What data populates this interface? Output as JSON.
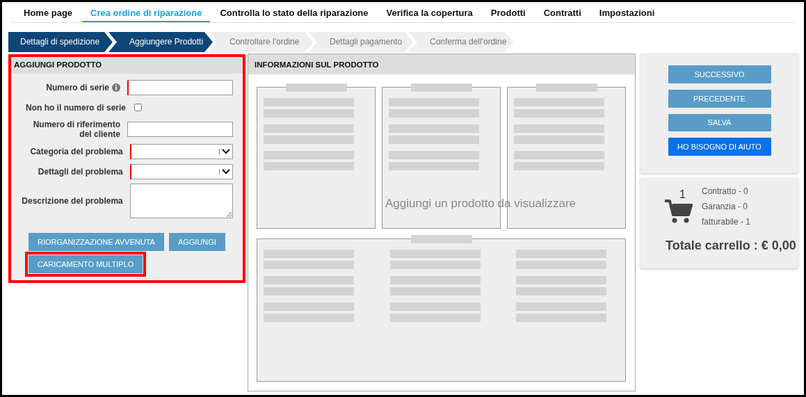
{
  "nav": [
    {
      "label": "Home page",
      "selected": false
    },
    {
      "label": "Crea ordine di riparazione",
      "selected": true
    },
    {
      "label": "Controlla lo stato della riparazione",
      "selected": false
    },
    {
      "label": "Verifica la copertura",
      "selected": false
    },
    {
      "label": "Prodotti",
      "selected": false
    },
    {
      "label": "Contratti",
      "selected": false
    },
    {
      "label": "Impostazioni",
      "selected": false
    }
  ],
  "steps": [
    {
      "label": "Dettagli di spedizione",
      "done": true
    },
    {
      "label": "Aggiungere Prodotti",
      "done": true
    },
    {
      "label": "Controllare l'ordine",
      "done": false
    },
    {
      "label": "Dettagli pagamento",
      "done": false
    },
    {
      "label": "Conferma dell'ordine",
      "done": false
    }
  ],
  "add_product": {
    "title": "AGGIUNGI PRODOTTO",
    "highlighted": true,
    "fields": [
      {
        "kind": "text",
        "label": "Numero di serie",
        "info": true,
        "required": true
      },
      {
        "kind": "checkbox",
        "label": "Non ho il numero di serie",
        "checked": false
      },
      {
        "kind": "text",
        "label": "Numero di riferimento del cliente",
        "info": false,
        "required": false
      },
      {
        "kind": "select",
        "label": "Categoria del problema",
        "required": true
      },
      {
        "kind": "select",
        "label": "Dettagli del problema",
        "required": true
      },
      {
        "kind": "textarea",
        "label": "Descrizione del problema",
        "required": false
      }
    ],
    "buttons": [
      {
        "label": "RIORGANIZZAZIONE AVVENUTA",
        "highlighted": false
      },
      {
        "label": "AGGIUNGI",
        "highlighted": false
      },
      {
        "label": "CARICAMENTO MULTIPLO",
        "highlighted": true
      }
    ]
  },
  "product_info": {
    "title": "INFORMAZIONI SUL PRODOTTO",
    "empty_message": "Aggiungi un prodotto da visualizzare"
  },
  "actions": [
    {
      "label": "SUCCESSIVO",
      "kind": "secondary"
    },
    {
      "label": "PRECEDENTE",
      "kind": "secondary"
    },
    {
      "label": "SALVA",
      "kind": "secondary"
    },
    {
      "label": "HO BISOGNO DI AIUTO",
      "kind": "primary"
    }
  ],
  "cart": {
    "count": "1",
    "lines": [
      "Contratto - 0",
      "Garanzia - 0",
      "fatturabile - 1"
    ],
    "total": "Totale carrello : € 0,00"
  }
}
